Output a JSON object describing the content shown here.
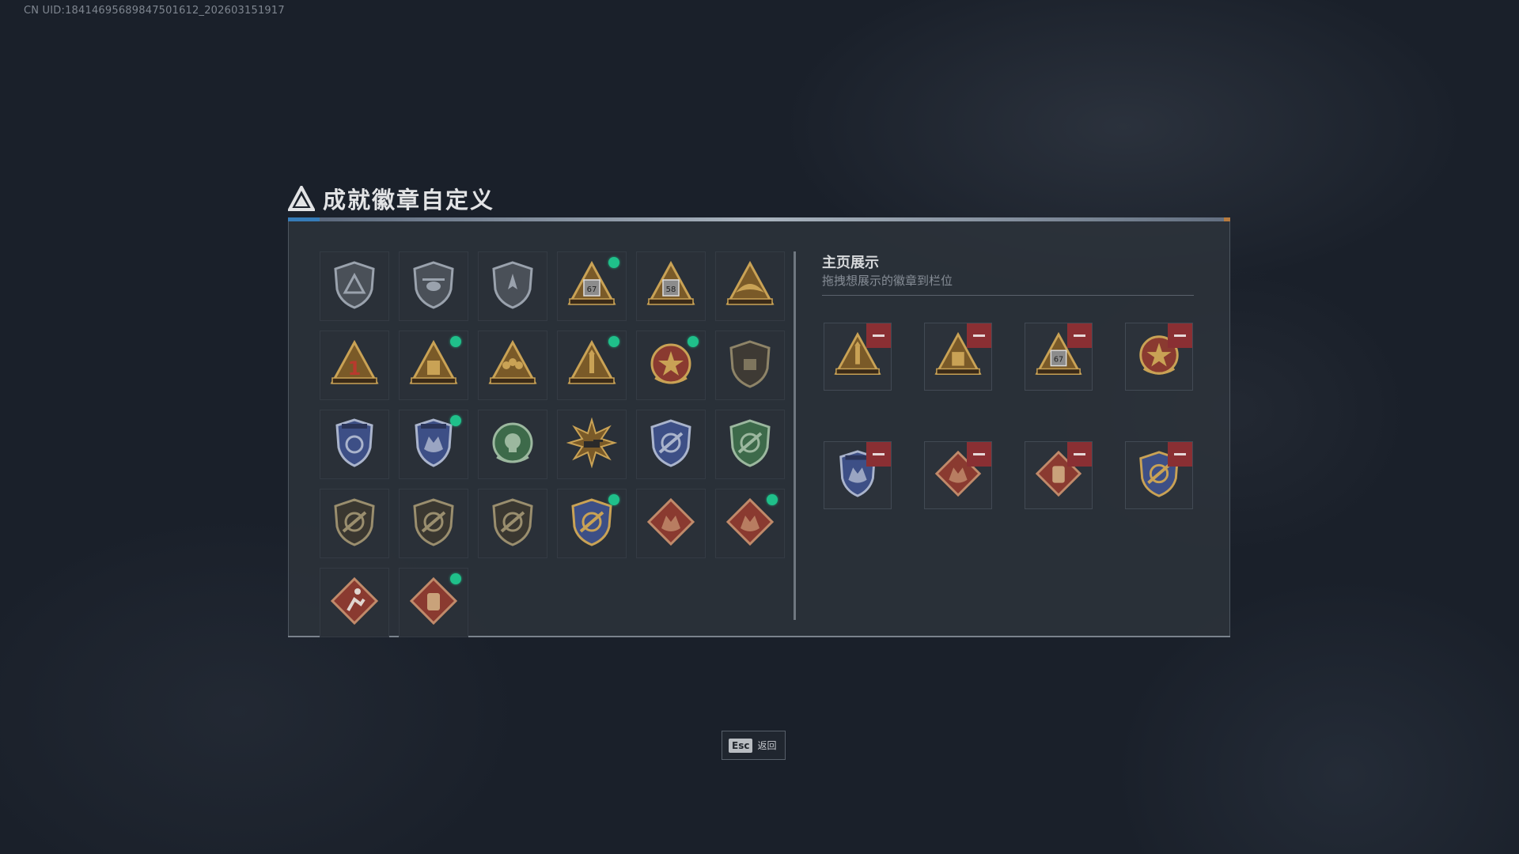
{
  "uid_text": "CN UID:18414695689847501612_202603151917",
  "title": "成就徽章自定义",
  "showcase": {
    "title": "主页展示",
    "subtitle": "拖拽想展示的徽章到栏位"
  },
  "footer": {
    "esc_key": "Esc",
    "esc_label": "返回"
  },
  "colors": {
    "panel_bg": "#2e343c",
    "accent_green": "#1fc08a",
    "remove_red": "#8a2f33",
    "gold": "#c9a255"
  },
  "badges": [
    {
      "icon": "shield-triangle-badge",
      "new": false
    },
    {
      "icon": "helicopter-shield-badge",
      "new": false
    },
    {
      "icon": "jet-shield-badge",
      "new": false
    },
    {
      "icon": "supply-67-badge",
      "label": "67",
      "new": true
    },
    {
      "icon": "supply-58-badge",
      "label": "58",
      "new": false
    },
    {
      "icon": "gold-wing-badge",
      "new": false
    },
    {
      "icon": "rank-1-badge",
      "label": "1",
      "new": false
    },
    {
      "icon": "supply-crate-badge",
      "new": true
    },
    {
      "icon": "squad-badge",
      "new": false
    },
    {
      "icon": "rocket-badge",
      "new": true
    },
    {
      "icon": "star-medal-badge",
      "new": true
    },
    {
      "icon": "hand-shield-badge",
      "new": false
    },
    {
      "icon": "blue-crest-badge",
      "new": false
    },
    {
      "icon": "blue-beast-crest-badge",
      "new": true
    },
    {
      "icon": "green-skull-badge",
      "new": false
    },
    {
      "icon": "sun-tank-badge",
      "new": false
    },
    {
      "icon": "blue-rifle-shield-badge",
      "new": false
    },
    {
      "icon": "green-rifle-shield-badge",
      "new": false
    },
    {
      "icon": "scope-shield-badge-1",
      "new": false
    },
    {
      "icon": "scope-shield-badge-2",
      "new": false
    },
    {
      "icon": "scope-shield-badge-3",
      "new": false
    },
    {
      "icon": "gold-rifle-shield-badge",
      "new": true
    },
    {
      "icon": "wolf-diamond-badge",
      "new": false
    },
    {
      "icon": "dragon-diamond-badge",
      "new": true
    },
    {
      "icon": "runner-diamond-badge",
      "new": false
    },
    {
      "icon": "vest-diamond-badge",
      "new": true
    }
  ],
  "slots": [
    {
      "icon": "rocket-badge"
    },
    {
      "icon": "supply-crate-badge"
    },
    {
      "icon": "supply-67-badge",
      "label": "67"
    },
    {
      "icon": "star-medal-badge"
    },
    {
      "icon": "blue-beast-crest-badge"
    },
    {
      "icon": "dragon-diamond-badge"
    },
    {
      "icon": "vest-diamond-badge"
    },
    {
      "icon": "gold-rifle-shield-badge"
    }
  ]
}
